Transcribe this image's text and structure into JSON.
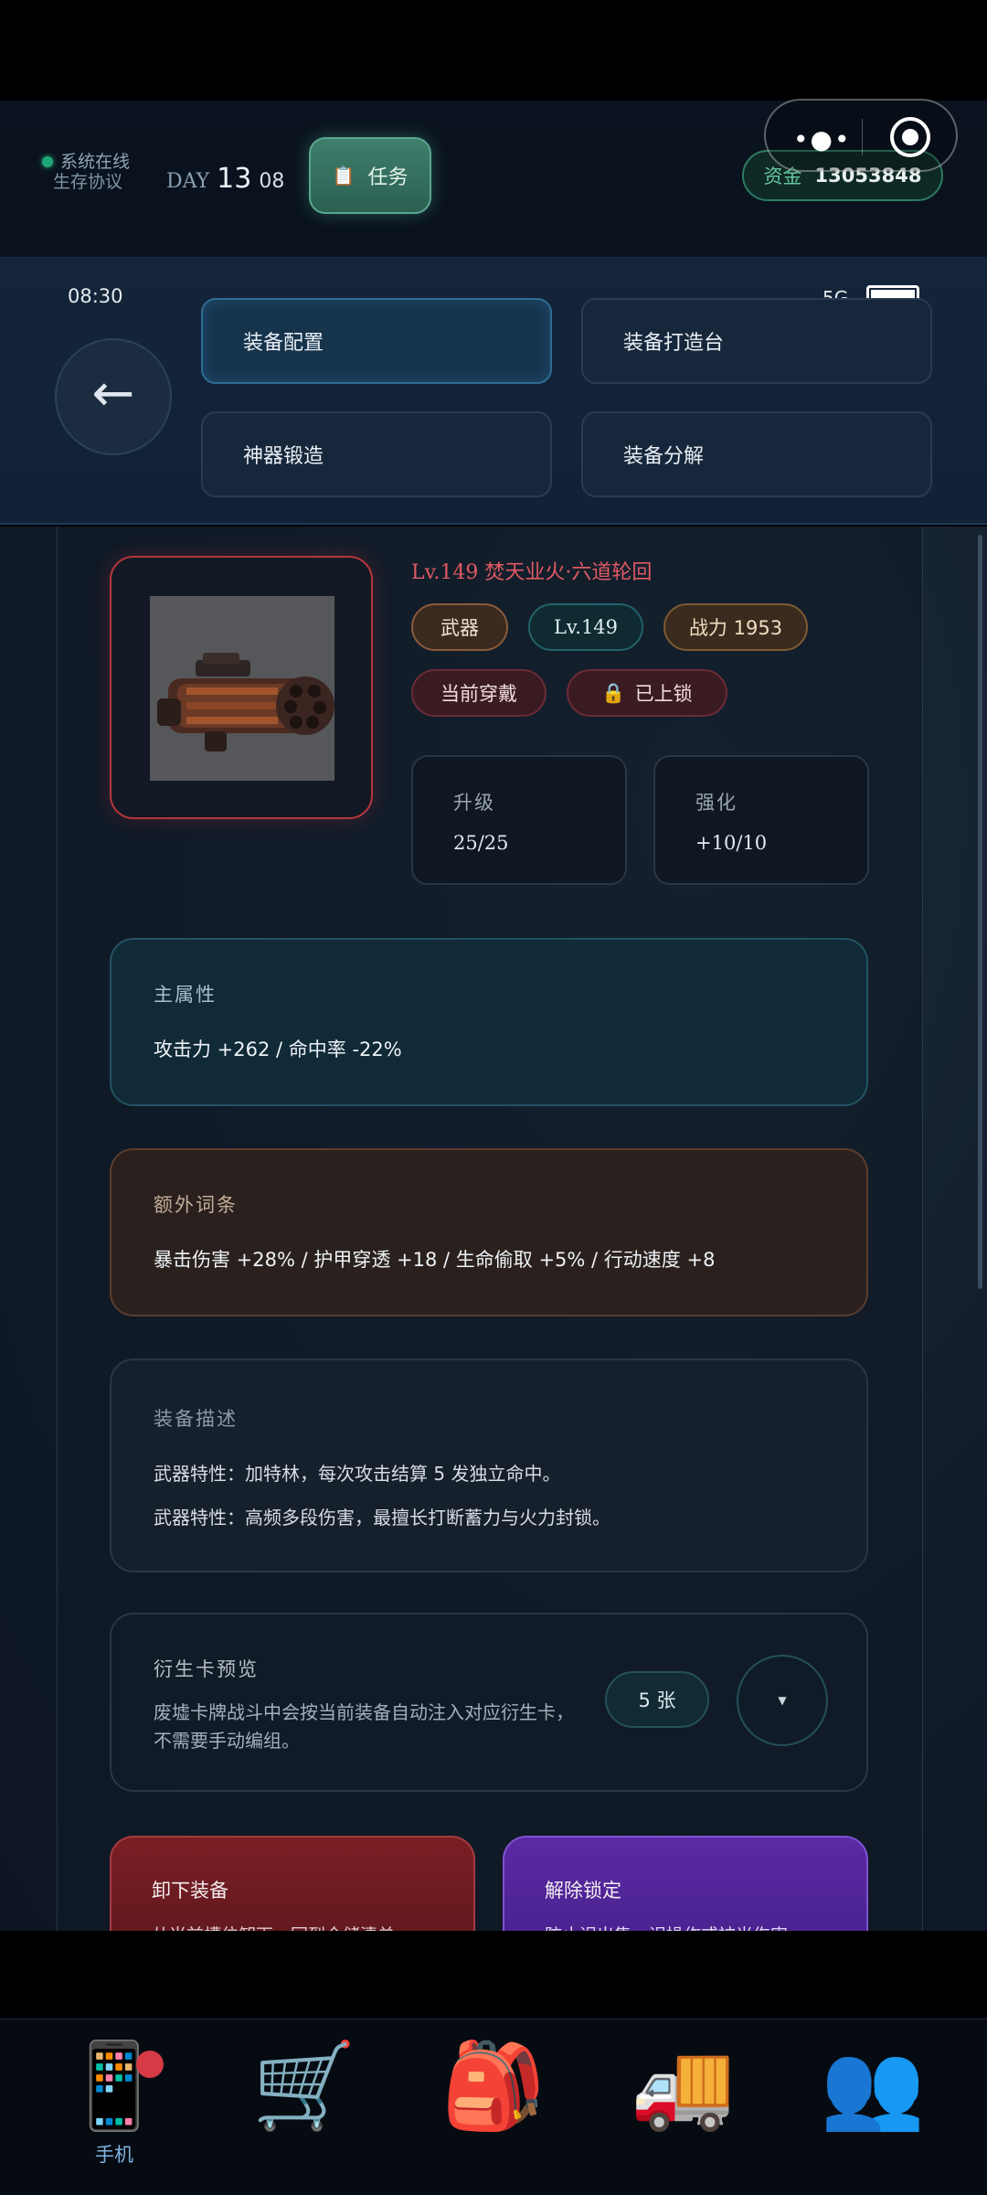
{
  "header": {
    "status": "系统在线",
    "protocol": "生存协议",
    "day_label": "DAY",
    "day_number": "13",
    "hour": "08",
    "task_icon": "clipboard-icon",
    "task_label": "任务",
    "funds_label": "资金",
    "funds_value": "13053848",
    "capsule_more": "•●•",
    "status_color": "#1fa77a"
  },
  "statusbar": {
    "time": "08:30",
    "signal": "5G"
  },
  "nav": {
    "items": [
      {
        "label": "装备配置",
        "active": true
      },
      {
        "label": "装备打造台",
        "active": false
      },
      {
        "label": "神器锻造",
        "active": false
      },
      {
        "label": "装备分解",
        "active": false
      }
    ]
  },
  "item": {
    "name": "Lv.149 焚天业火·六道轮回",
    "image": "gatling-gun-image",
    "tags": {
      "type": "武器",
      "level": "Lv.149",
      "power": "战力 1953",
      "worn": "当前穿戴",
      "locked": "已上锁",
      "lock_icon": "lock-icon"
    },
    "rarity_color": "#b5363d",
    "upgrade": {
      "label": "升级",
      "value": "25/25"
    },
    "enhance": {
      "label": "强化",
      "value": "+10/10"
    }
  },
  "main_attr": {
    "title": "主属性",
    "text": "攻击力 +262 / 命中率 -22%"
  },
  "extra_attr": {
    "title": "额外词条",
    "text": "暴击伤害 +28% / 护甲穿透 +18 / 生命偷取 +5% / 行动速度 +8"
  },
  "description": {
    "title": "装备描述",
    "line1": "武器特性：加特林，每次攻击结算 5 发独立命中。",
    "line2": "武器特性：高频多段伤害，最擅长打断蓄力与火力封锁。"
  },
  "derivative": {
    "title": "衍生卡预览",
    "note": "废墟卡牌战斗中会按当前装备自动注入对应衍生卡，不需要手动编组。",
    "count": "5 张",
    "toggle": "▼"
  },
  "actions": {
    "unequip": {
      "title": "卸下装备",
      "sub": "从当前槽位卸下，回到仓储清单"
    },
    "unlock": {
      "title": "解除锁定",
      "sub": "防止误出售、误操作或被光伤害"
    }
  },
  "tabbar": {
    "items": [
      {
        "icon": "mobile-phone-icon",
        "glyph": "📱",
        "label": "手机",
        "badge": true
      },
      {
        "icon": "shopping-cart-icon",
        "glyph": "🛒",
        "label": ""
      },
      {
        "icon": "backpack-icon",
        "glyph": "🎒",
        "label": ""
      },
      {
        "icon": "truck-icon",
        "glyph": "🚚",
        "label": ""
      },
      {
        "icon": "people-icon",
        "glyph": "👥",
        "label": ""
      }
    ]
  }
}
